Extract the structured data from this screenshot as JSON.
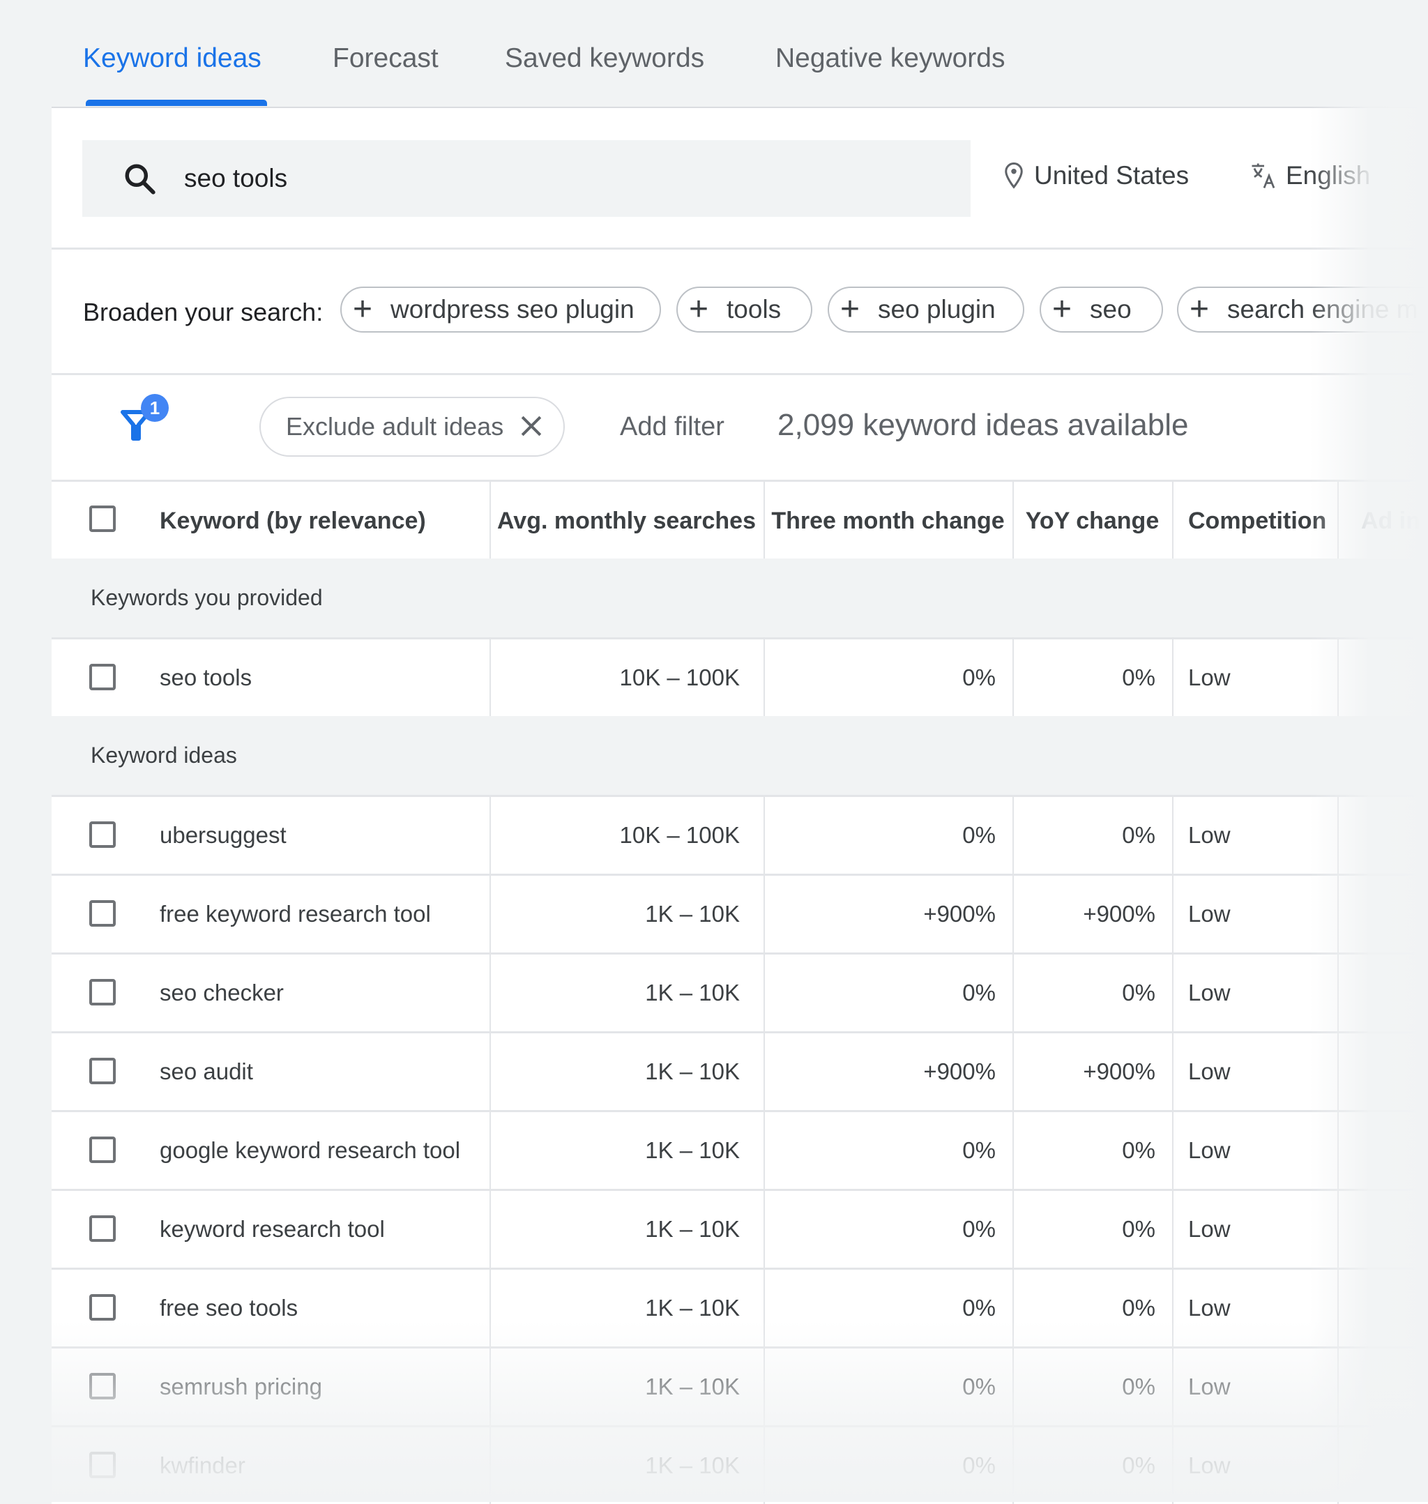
{
  "tabs": [
    {
      "label": "Keyword ideas",
      "active": true
    },
    {
      "label": "Forecast",
      "active": false
    },
    {
      "label": "Saved keywords",
      "active": false
    },
    {
      "label": "Negative keywords",
      "active": false
    }
  ],
  "search": {
    "value": "seo tools",
    "icon": "search-icon"
  },
  "location": {
    "label": "United States",
    "icon": "location-pin-icon"
  },
  "language": {
    "label": "English",
    "icon": "translate-icon"
  },
  "broaden": {
    "label": "Broaden your search:",
    "chips": [
      "wordpress seo plugin",
      "tools",
      "seo plugin",
      "seo",
      "search engine m"
    ]
  },
  "filters": {
    "badge_count": "1",
    "active_filter": "Exclude adult ideas",
    "add_filter_label": "Add filter",
    "results_count": "2,099 keyword ideas available"
  },
  "table": {
    "columns": [
      "Keyword (by relevance)",
      "Avg. monthly searches",
      "Three month change",
      "YoY change",
      "Competition",
      "Ad in"
    ],
    "sections": [
      {
        "title": "Keywords you provided",
        "rows": [
          {
            "keyword": "seo tools",
            "searches": "10K – 100K",
            "three_month": "0%",
            "yoy": "0%",
            "competition": "Low"
          }
        ]
      },
      {
        "title": "Keyword ideas",
        "rows": [
          {
            "keyword": "ubersuggest",
            "searches": "10K – 100K",
            "three_month": "0%",
            "yoy": "0%",
            "competition": "Low"
          },
          {
            "keyword": "free keyword research tool",
            "searches": "1K – 10K",
            "three_month": "+900%",
            "yoy": "+900%",
            "competition": "Low"
          },
          {
            "keyword": "seo checker",
            "searches": "1K – 10K",
            "three_month": "0%",
            "yoy": "0%",
            "competition": "Low"
          },
          {
            "keyword": "seo audit",
            "searches": "1K – 10K",
            "three_month": "+900%",
            "yoy": "+900%",
            "competition": "Low"
          },
          {
            "keyword": "google keyword research tool",
            "searches": "1K – 10K",
            "three_month": "0%",
            "yoy": "0%",
            "competition": "Low"
          },
          {
            "keyword": "keyword research tool",
            "searches": "1K – 10K",
            "three_month": "0%",
            "yoy": "0%",
            "competition": "Low"
          },
          {
            "keyword": "free seo tools",
            "searches": "1K – 10K",
            "three_month": "0%",
            "yoy": "0%",
            "competition": "Low"
          },
          {
            "keyword": "semrush pricing",
            "searches": "1K – 10K",
            "three_month": "0%",
            "yoy": "0%",
            "competition": "Low"
          },
          {
            "keyword": "kwfinder",
            "searches": "1K – 10K",
            "three_month": "0%",
            "yoy": "0%",
            "competition": "Low"
          }
        ]
      }
    ]
  },
  "colors": {
    "accent": "#1a73e8",
    "badge": "#4285f4"
  }
}
